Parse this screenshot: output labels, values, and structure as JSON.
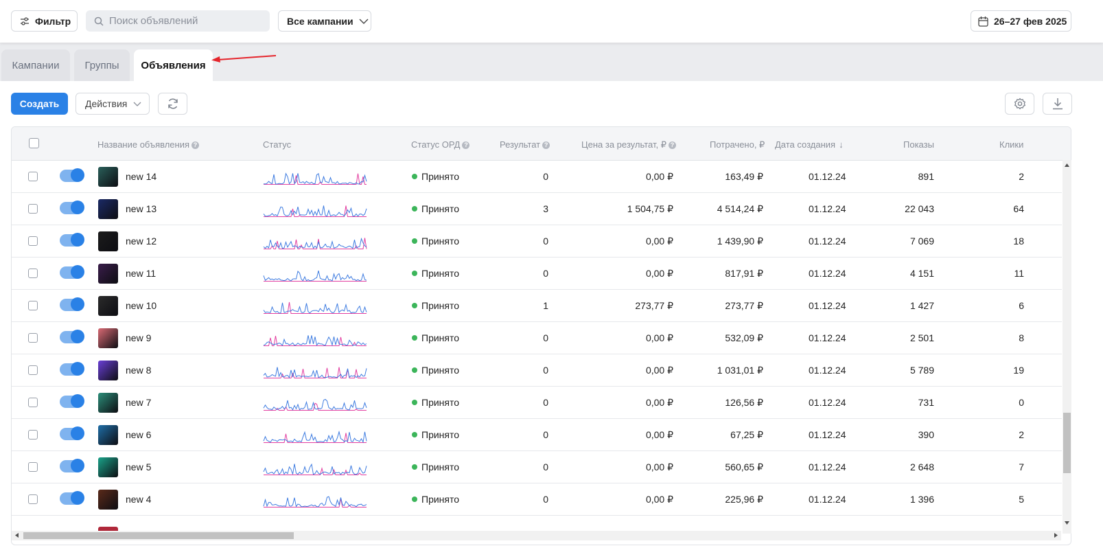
{
  "topbar": {
    "filter_label": "Фильтр",
    "search_placeholder": "Поиск объявлений",
    "campaign_select": "Все кампании",
    "date_range": "26–27 фев 2025"
  },
  "tabs": [
    {
      "label": "Кампании",
      "active": false
    },
    {
      "label": "Группы",
      "active": false
    },
    {
      "label": "Объявления",
      "active": true
    }
  ],
  "toolbar": {
    "create_label": "Создать",
    "actions_label": "Действия"
  },
  "table": {
    "columns": {
      "name": "Название объявления",
      "status": "Статус",
      "ord_status": "Статус ОРД",
      "result": "Результат",
      "cost_per_result": "Цена за результат, ₽",
      "spent": "Потрачено, ₽",
      "created": "Дата создания",
      "impressions": "Показы",
      "clicks": "Клики"
    },
    "rows": [
      {
        "name": "new 14",
        "ord": "Принято",
        "result": "0",
        "cpr": "0,00 ₽",
        "spent": "163,49 ₽",
        "date": "01.12.24",
        "impressions": "891",
        "clicks": "2"
      },
      {
        "name": "new 13",
        "ord": "Принято",
        "result": "3",
        "cpr": "1 504,75 ₽",
        "spent": "4 514,24 ₽",
        "date": "01.12.24",
        "impressions": "22 043",
        "clicks": "64"
      },
      {
        "name": "new 12",
        "ord": "Принято",
        "result": "0",
        "cpr": "0,00 ₽",
        "spent": "1 439,90 ₽",
        "date": "01.12.24",
        "impressions": "7 069",
        "clicks": "18"
      },
      {
        "name": "new 11",
        "ord": "Принято",
        "result": "0",
        "cpr": "0,00 ₽",
        "spent": "817,91 ₽",
        "date": "01.12.24",
        "impressions": "4 151",
        "clicks": "11"
      },
      {
        "name": "new 10",
        "ord": "Принято",
        "result": "1",
        "cpr": "273,77 ₽",
        "spent": "273,77 ₽",
        "date": "01.12.24",
        "impressions": "1 427",
        "clicks": "6"
      },
      {
        "name": "new 9",
        "ord": "Принято",
        "result": "0",
        "cpr": "0,00 ₽",
        "spent": "532,09 ₽",
        "date": "01.12.24",
        "impressions": "2 501",
        "clicks": "8"
      },
      {
        "name": "new 8",
        "ord": "Принято",
        "result": "0",
        "cpr": "0,00 ₽",
        "spent": "1 031,01 ₽",
        "date": "01.12.24",
        "impressions": "5 789",
        "clicks": "19"
      },
      {
        "name": "new 7",
        "ord": "Принято",
        "result": "0",
        "cpr": "0,00 ₽",
        "spent": "126,56 ₽",
        "date": "01.12.24",
        "impressions": "731",
        "clicks": "0"
      },
      {
        "name": "new 6",
        "ord": "Принято",
        "result": "0",
        "cpr": "0,00 ₽",
        "spent": "67,25 ₽",
        "date": "01.12.24",
        "impressions": "390",
        "clicks": "2"
      },
      {
        "name": "new 5",
        "ord": "Принято",
        "result": "0",
        "cpr": "0,00 ₽",
        "spent": "560,65 ₽",
        "date": "01.12.24",
        "impressions": "2 648",
        "clicks": "7"
      },
      {
        "name": "new 4",
        "ord": "Принято",
        "result": "0",
        "cpr": "0,00 ₽",
        "spent": "225,96 ₽",
        "date": "01.12.24",
        "impressions": "1 396",
        "clicks": "5"
      }
    ]
  },
  "colors": {
    "accent": "#2a81e6",
    "status_green": "#3cb55a",
    "spark_blue": "#3d7be0",
    "spark_pink": "#e23ea0",
    "arrow_red": "#e5242b"
  }
}
